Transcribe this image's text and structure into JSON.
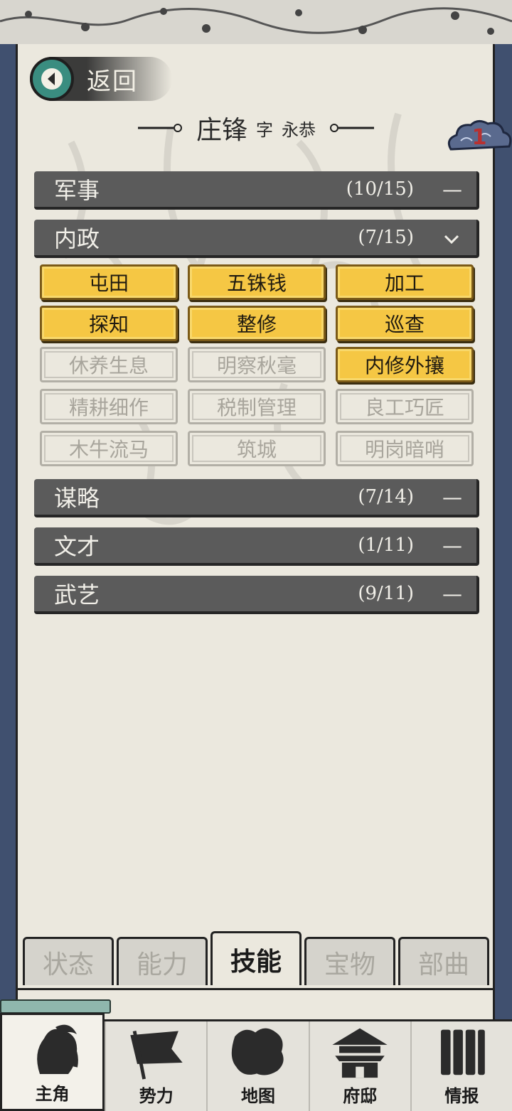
{
  "header": {
    "back_label": "返回",
    "name": "庄锋",
    "zi_mark": "字",
    "zi": "永恭",
    "badge_count": "1"
  },
  "sections": [
    {
      "name": "军事",
      "count": "(10/15)",
      "icon": "minus-icon",
      "expanded": false
    },
    {
      "name": "内政",
      "count": "(7/15)",
      "icon": "chevron-down-icon",
      "expanded": true
    },
    {
      "name": "谋略",
      "count": "(7/14)",
      "icon": "minus-icon",
      "expanded": false
    },
    {
      "name": "文才",
      "count": "(1/11)",
      "icon": "minus-icon",
      "expanded": false
    },
    {
      "name": "武艺",
      "count": "(9/11)",
      "icon": "minus-icon",
      "expanded": false
    }
  ],
  "skills": [
    {
      "label": "屯田",
      "learned": true
    },
    {
      "label": "五铢钱",
      "learned": true
    },
    {
      "label": "加工",
      "learned": true
    },
    {
      "label": "探知",
      "learned": true
    },
    {
      "label": "整修",
      "learned": true
    },
    {
      "label": "巡查",
      "learned": true
    },
    {
      "label": "休养生息",
      "learned": false
    },
    {
      "label": "明察秋毫",
      "learned": false
    },
    {
      "label": "内修外攘",
      "learned": true
    },
    {
      "label": "精耕细作",
      "learned": false
    },
    {
      "label": "税制管理",
      "learned": false
    },
    {
      "label": "良工巧匠",
      "learned": false
    },
    {
      "label": "木牛流马",
      "learned": false
    },
    {
      "label": "筑城",
      "learned": false
    },
    {
      "label": "明岗暗哨",
      "learned": false
    }
  ],
  "tabs": [
    {
      "label": "状态",
      "active": false
    },
    {
      "label": "能力",
      "active": false
    },
    {
      "label": "技能",
      "active": true
    },
    {
      "label": "宝物",
      "active": false
    },
    {
      "label": "部曲",
      "active": false
    }
  ],
  "nav": [
    {
      "label": "主角",
      "icon": "hero-portrait-icon",
      "active": true
    },
    {
      "label": "势力",
      "icon": "banner-flag-icon",
      "active": false
    },
    {
      "label": "地图",
      "icon": "map-icon",
      "active": false
    },
    {
      "label": "府邸",
      "icon": "mansion-icon",
      "active": false
    },
    {
      "label": "情报",
      "icon": "scroll-icon",
      "active": false
    }
  ],
  "colors": {
    "learned": "#f5c744",
    "bar": "#5b5b5b",
    "paper": "#ebe8de",
    "border": "#40506f",
    "badge_text": "#b73131"
  }
}
